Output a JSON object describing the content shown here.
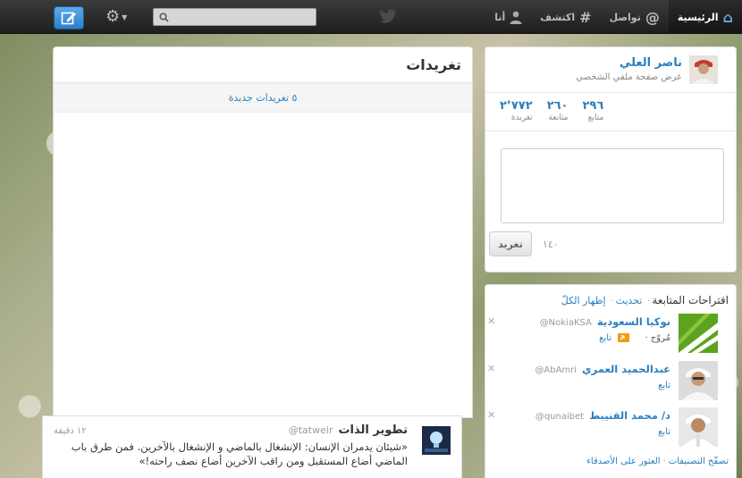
{
  "topbar": {
    "nav": [
      {
        "label": "الرئيسية",
        "icon": "home-icon",
        "active": true
      },
      {
        "label": "تواصل",
        "icon": "at-icon"
      },
      {
        "label": "اكتشف",
        "icon": "hash-icon"
      },
      {
        "label": "أنا",
        "icon": "person-icon"
      }
    ],
    "search_value": ""
  },
  "timeline": {
    "title": "تغريدات",
    "new_tweets": "٥ تغريدات جديدة"
  },
  "tweet": {
    "name": "تطوير الذات",
    "handle": "@tatweir",
    "time": "١٢ دقيقة",
    "text": "«شيئان يدمران الإنسان: الإنشغال بالماضي و الإنشغال بالآخرين. فمن طرق باب الماضي أضاع المستقبل ومن راقب الآخرين أضاع نصف راحته!»"
  },
  "profile": {
    "name": "ناصر العلي",
    "subtitle": "عرض صفحة ملفي الشخصي",
    "stats": [
      {
        "num": "٢٬٧٧٢",
        "label": "تغريدة"
      },
      {
        "num": "٢٦٠",
        "label": "متابعة"
      },
      {
        "num": "٢٩٦",
        "label": "متابع"
      }
    ],
    "counter": "١٤٠",
    "tweet_button": "تغريد"
  },
  "suggestions": {
    "title": "اقتراحات المتابعة",
    "refresh": "تحديث",
    "show_all": "إظهار الكلّ",
    "items": [
      {
        "name": "نوكيا السعودية",
        "handle": "@NokiaKSA",
        "action": "مُروّج ·",
        "follow": "تابع"
      },
      {
        "name": "عبدالحميد العمري",
        "handle": "@AbAmri",
        "action": "تابع"
      },
      {
        "name": "د/ محمد القنيبط",
        "handle": "@qunaibet",
        "action": "تابع"
      }
    ],
    "footer_browse": "تصفّح التصنيفات",
    "footer_find": "العثور على الأصدقاء"
  },
  "colors": {
    "accent": "#2a7fbf",
    "topbar": "#2b2b2b"
  }
}
